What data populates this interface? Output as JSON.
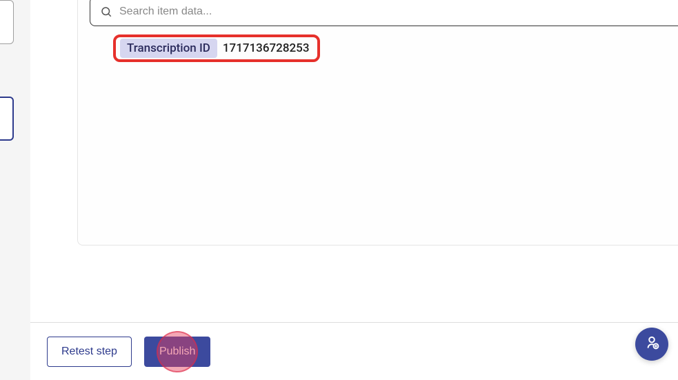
{
  "search": {
    "placeholder": "Search item data..."
  },
  "tag": {
    "label": "Transcription ID",
    "value": "1717136728253"
  },
  "footer": {
    "retest_label": "Retest step",
    "publish_label": "Publish"
  }
}
